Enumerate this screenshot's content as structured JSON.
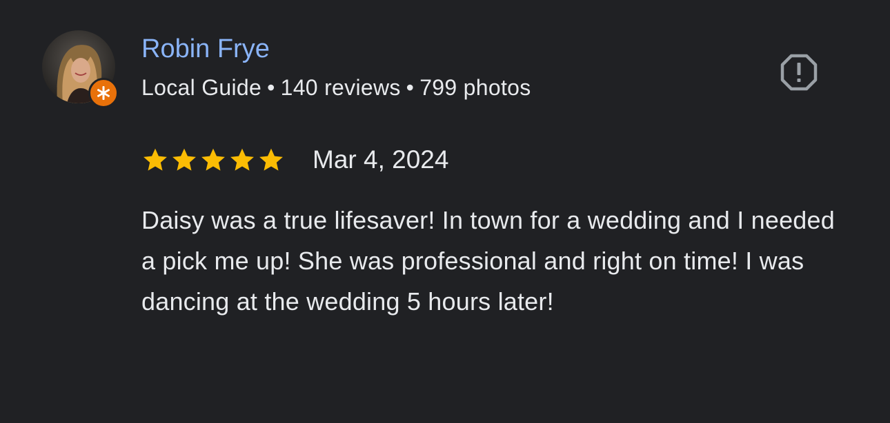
{
  "reviewer": {
    "name": "Robin Frye",
    "guide_label": "Local Guide",
    "separator": "•",
    "reviews_count": "140 reviews",
    "photos_count": "799 photos",
    "avatar_icon": "user-photo",
    "badge_icon": "local-guide-star-icon"
  },
  "review": {
    "rating": 5,
    "rating_max": 5,
    "date": "Mar 4, 2024",
    "text": "Daisy was a true lifesaver! In town for a wedding and I needed a pick me up! She was professional and right on time! I was dancing at the wedding 5 hours later!"
  },
  "actions": {
    "report_icon": "report-octagon-icon"
  },
  "colors": {
    "background": "#202124",
    "name": "#8ab4f8",
    "text": "#e8eaed",
    "star": "#fbbc04",
    "badge": "#e8710a",
    "icon": "#9aa0a6"
  }
}
